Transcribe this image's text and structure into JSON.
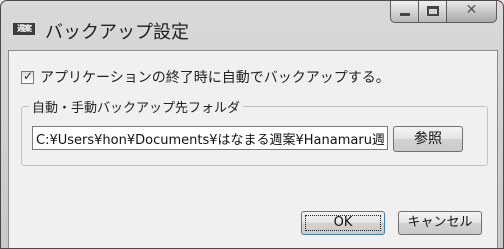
{
  "window": {
    "title": "バックアップ設定",
    "icon_text": "週案",
    "icon": "app-icon",
    "minimize_icon": "minimize-icon",
    "maximize_icon": "maximize-icon",
    "close_icon": "close-icon",
    "close_glyph": "✕"
  },
  "options": {
    "auto_backup_label": "アプリケーションの終了時に自動でバックアップする。",
    "auto_backup_checked": true,
    "check_glyph": "✓"
  },
  "backup_folder": {
    "group_label": "自動・手動バックアップ先フォルダ",
    "path_value": "C:¥Users¥hon¥Documents¥はなまる週案¥Hanamaru週",
    "browse_label": "参照"
  },
  "footer": {
    "ok_label": "OK",
    "cancel_label": "キャンセル"
  },
  "colors": {
    "page_background": "#f5dfea",
    "window_frame": "#c9c9c9",
    "client_background": "#f0f0f0",
    "default_button_border": "#3c7fb1"
  }
}
